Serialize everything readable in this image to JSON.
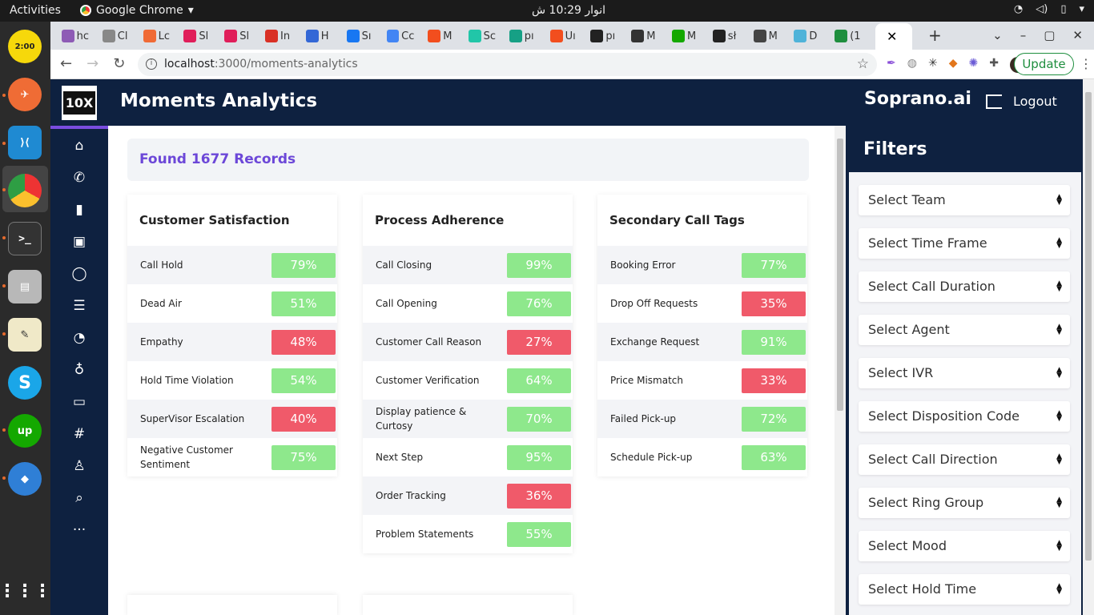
{
  "system": {
    "activities": "Activities",
    "app_name": "Google Chrome",
    "clock": "انوار 10:29 ش"
  },
  "browser": {
    "url_host": "localhost",
    "url_path": ":3000/moments-analytics",
    "update_label": "Update",
    "tabs": [
      "hc",
      "Cl",
      "Lc",
      "Sl",
      "Sl",
      "In",
      "H",
      "Sı",
      "Cc",
      "M",
      "Sc",
      "pı",
      "Uı",
      "pı",
      "M",
      "M",
      "sł",
      "M",
      "D",
      "(1"
    ]
  },
  "header": {
    "logo": "10X",
    "title": "Moments Analytics",
    "brand": "Soprano.ai",
    "logout": "Logout"
  },
  "records_label": "Found 1677 Records",
  "cards": [
    {
      "title": "Customer Satisfaction",
      "rows": [
        {
          "label": "Call Hold",
          "value": "79%",
          "status": "good"
        },
        {
          "label": "Dead Air",
          "value": "51%",
          "status": "good"
        },
        {
          "label": "Empathy",
          "value": "48%",
          "status": "bad"
        },
        {
          "label": "Hold Time Violation",
          "value": "54%",
          "status": "good"
        },
        {
          "label": "SuperVisor Escalation",
          "value": "40%",
          "status": "bad"
        },
        {
          "label": "Negative Customer Sentiment",
          "value": "75%",
          "status": "good"
        }
      ]
    },
    {
      "title": "Process Adherence",
      "rows": [
        {
          "label": "Call Closing",
          "value": "99%",
          "status": "good"
        },
        {
          "label": "Call Opening",
          "value": "76%",
          "status": "good"
        },
        {
          "label": "Customer Call Reason",
          "value": "27%",
          "status": "bad"
        },
        {
          "label": "Customer Verification",
          "value": "64%",
          "status": "good"
        },
        {
          "label": "Display patience & Curtosy",
          "value": "70%",
          "status": "good"
        },
        {
          "label": "Next Step",
          "value": "95%",
          "status": "good"
        },
        {
          "label": "Order Tracking",
          "value": "36%",
          "status": "bad"
        },
        {
          "label": "Problem Statements",
          "value": "55%",
          "status": "good"
        }
      ]
    },
    {
      "title": "Secondary Call Tags",
      "rows": [
        {
          "label": "Booking Error",
          "value": "77%",
          "status": "good"
        },
        {
          "label": "Drop Off Requests",
          "value": "35%",
          "status": "bad"
        },
        {
          "label": "Exchange Request",
          "value": "91%",
          "status": "good"
        },
        {
          "label": "Price Mismatch",
          "value": "33%",
          "status": "bad"
        },
        {
          "label": "Failed Pick-up",
          "value": "72%",
          "status": "good"
        },
        {
          "label": "Schedule Pick-up",
          "value": "63%",
          "status": "good"
        }
      ]
    }
  ],
  "filters": {
    "title": "Filters",
    "selects": [
      "Select Team",
      "Select Time Frame",
      "Select Call Duration",
      "Select Agent",
      "Select IVR",
      "Select Disposition Code",
      "Select Call Direction",
      "Select Ring Group",
      "Select Mood",
      "Select Hold Time"
    ]
  },
  "colors": {
    "navy": "#0e2140",
    "good": "#8ee88c",
    "bad": "#f05a6a",
    "accent": "#6c47d8"
  }
}
